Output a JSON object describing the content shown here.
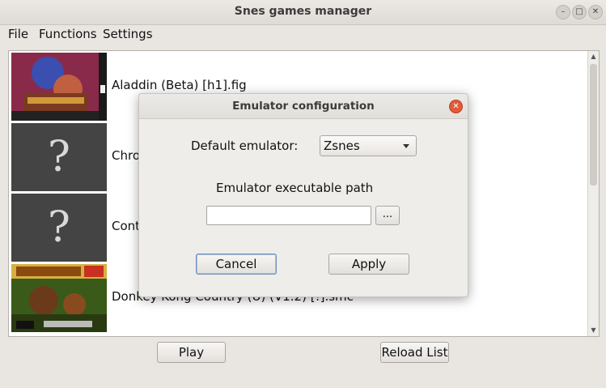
{
  "window": {
    "title": "Snes games manager"
  },
  "menu": [
    "File",
    "Functions",
    "Settings"
  ],
  "games": [
    {
      "label": "Aladdin (Beta) [h1].fig",
      "cover": "cover-art"
    },
    {
      "label": "Chro",
      "cover": "unknown"
    },
    {
      "label": "Contr",
      "cover": "unknown"
    },
    {
      "label": "Donkey Kong Country (U) (V1.2) [!].smc",
      "cover": "cover-art"
    }
  ],
  "unknown_glyph": "?",
  "buttons": {
    "play": "Play",
    "reload": "Reload List"
  },
  "dialog": {
    "title": "Emulator configuration",
    "default_emulator_label": "Default emulator:",
    "emulator_value": "Zsnes",
    "path_label": "Emulator executable path",
    "path_value": "",
    "browse_label": "...",
    "cancel_label": "Cancel",
    "apply_label": "Apply"
  },
  "colors": {
    "close_button": "#e15a3a"
  }
}
